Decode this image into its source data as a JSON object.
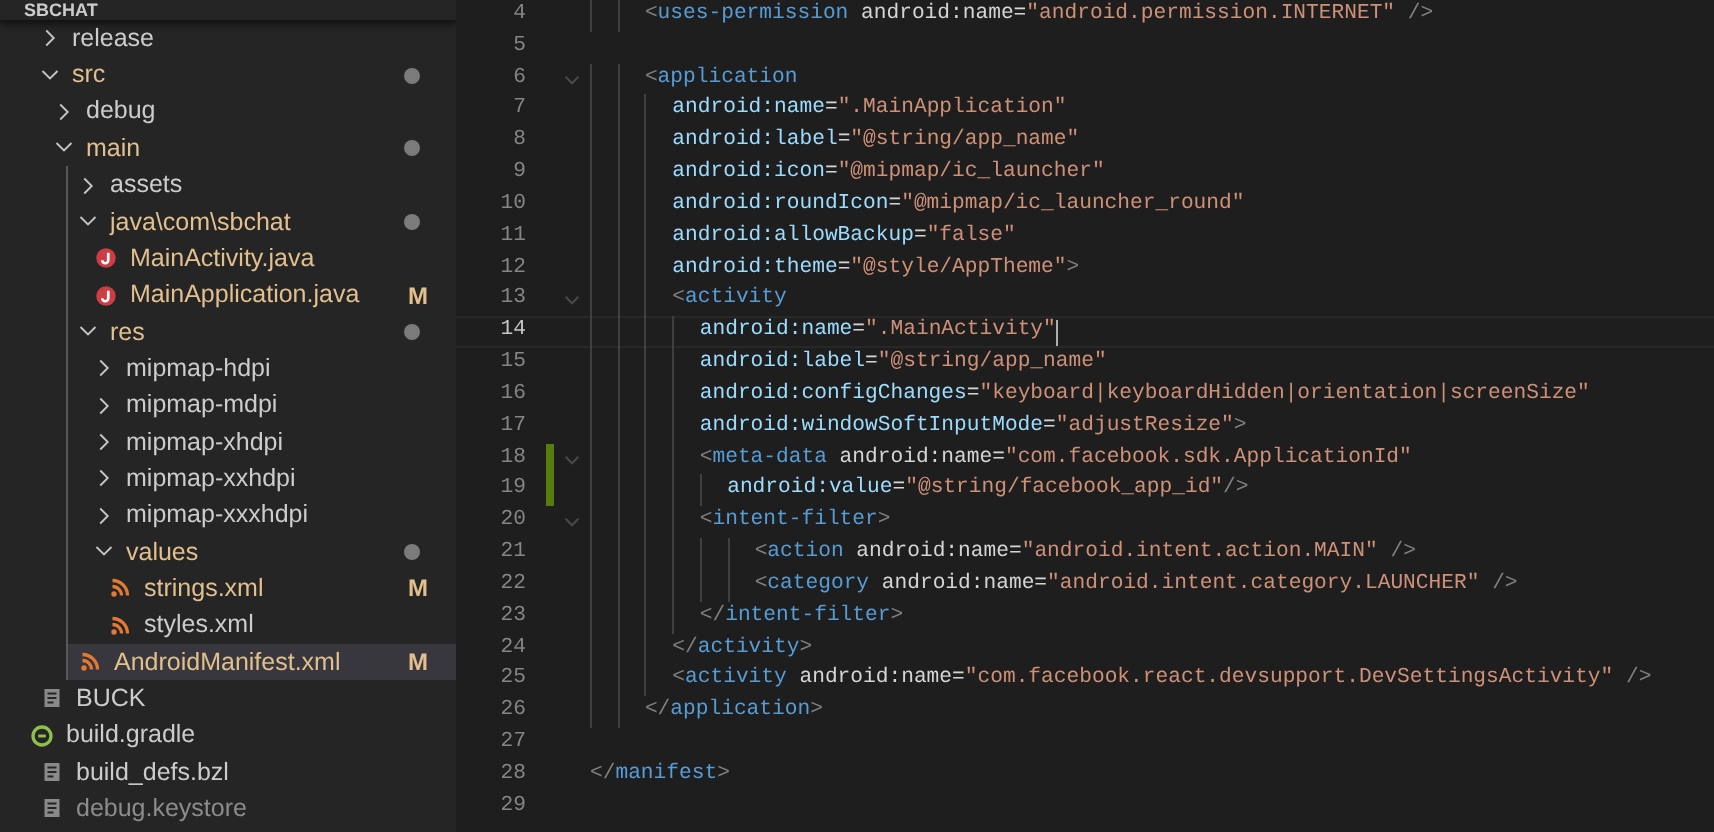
{
  "explorer": {
    "title": "SBCHAT",
    "items": [
      {
        "name": "release",
        "kind": "folder",
        "expanded": false,
        "selected": false,
        "contains_changes": false
      },
      {
        "name": "src",
        "kind": "folder",
        "expanded": true,
        "selected": false,
        "contains_changes": true,
        "children": [
          {
            "name": "debug",
            "kind": "folder",
            "expanded": false,
            "selected": false,
            "contains_changes": false
          },
          {
            "name": "main",
            "kind": "folder",
            "expanded": true,
            "selected": false,
            "contains_changes": true,
            "children": [
              {
                "name": "assets",
                "kind": "folder",
                "expanded": false,
                "selected": false,
                "contains_changes": false
              },
              {
                "name": "java\\com\\sbchat",
                "kind": "folder",
                "expanded": true,
                "selected": false,
                "contains_changes": true,
                "children": [
                  {
                    "name": "MainActivity.java",
                    "kind": "java",
                    "selected": false,
                    "modified": true,
                    "ignored": false
                  },
                  {
                    "name": "MainApplication.java",
                    "kind": "java",
                    "selected": false,
                    "modified": true,
                    "ignored": false,
                    "badge": "M"
                  }
                ]
              },
              {
                "name": "res",
                "kind": "folder",
                "expanded": true,
                "selected": false,
                "contains_changes": true,
                "children": [
                  {
                    "name": "mipmap-hdpi",
                    "kind": "folder",
                    "expanded": false,
                    "selected": false,
                    "contains_changes": false
                  },
                  {
                    "name": "mipmap-mdpi",
                    "kind": "folder",
                    "expanded": false,
                    "selected": false,
                    "contains_changes": false
                  },
                  {
                    "name": "mipmap-xhdpi",
                    "kind": "folder",
                    "expanded": false,
                    "selected": false,
                    "contains_changes": false
                  },
                  {
                    "name": "mipmap-xxhdpi",
                    "kind": "folder",
                    "expanded": false,
                    "selected": false,
                    "contains_changes": false
                  },
                  {
                    "name": "mipmap-xxxhdpi",
                    "kind": "folder",
                    "expanded": false,
                    "selected": false,
                    "contains_changes": false
                  },
                  {
                    "name": "values",
                    "kind": "folder",
                    "expanded": true,
                    "selected": false,
                    "contains_changes": true,
                    "children": [
                      {
                        "name": "strings.xml",
                        "kind": "xml",
                        "selected": false,
                        "modified": true,
                        "ignored": false,
                        "badge": "M"
                      },
                      {
                        "name": "styles.xml",
                        "kind": "xml",
                        "selected": false,
                        "modified": false,
                        "ignored": false
                      }
                    ]
                  }
                ]
              },
              {
                "name": "AndroidManifest.xml",
                "kind": "xml",
                "selected": true,
                "modified": true,
                "ignored": false,
                "badge": "M"
              }
            ]
          }
        ]
      },
      {
        "name": "BUCK",
        "kind": "file",
        "selected": false,
        "modified": false,
        "ignored": false
      },
      {
        "name": "build.gradle",
        "kind": "gradle",
        "selected": false,
        "modified": false,
        "ignored": false
      },
      {
        "name": "build_defs.bzl",
        "kind": "file",
        "selected": false,
        "modified": false,
        "ignored": false
      },
      {
        "name": "debug.keystore",
        "kind": "file",
        "selected": false,
        "modified": false,
        "ignored": true
      }
    ]
  },
  "editor": {
    "lines": [
      {
        "number": "4",
        "code": "    <uses-permission android:name=\"android.permission.INTERNET\" />"
      },
      {
        "number": "5"
      },
      {
        "number": "6",
        "code": "    <application",
        "fold": true
      },
      {
        "number": "7",
        "code": "      android:name=\".MainApplication\""
      },
      {
        "number": "8",
        "code": "      android:label=\"@string/app_name\""
      },
      {
        "number": "9",
        "code": "      android:icon=\"@mipmap/ic_launcher\""
      },
      {
        "number": "10",
        "code": "      android:roundIcon=\"@mipmap/ic_launcher_round\""
      },
      {
        "number": "11",
        "code": "      android:allowBackup=\"false\""
      },
      {
        "number": "12",
        "code": "      android:theme=\"@style/AppTheme\">"
      },
      {
        "number": "13",
        "code": "      <activity",
        "fold": true
      },
      {
        "number": "14",
        "code": "        android:name=\".MainActivity\"",
        "current": true
      },
      {
        "number": "15",
        "code": "        android:label=\"@string/app_name\""
      },
      {
        "number": "16",
        "code": "        android:configChanges=\"keyboard|keyboardHidden|orientation|screenSize\""
      },
      {
        "number": "17",
        "code": "        android:windowSoftInputMode=\"adjustResize\">"
      },
      {
        "number": "18",
        "code": "        <meta-data android:name=\"com.facebook.sdk.ApplicationId\"",
        "fold": true,
        "added": true
      },
      {
        "number": "19",
        "code": "          android:value=\"@string/facebook_app_id\"/>",
        "added": true
      },
      {
        "number": "20",
        "code": "        <intent-filter>",
        "fold": true
      },
      {
        "number": "21",
        "code": "            <action android:name=\"android.intent.action.MAIN\" />"
      },
      {
        "number": "22",
        "code": "            <category android:name=\"android.intent.category.LAUNCHER\" />"
      },
      {
        "number": "23",
        "code": "        </intent-filter>"
      },
      {
        "number": "24",
        "code": "      </activity>"
      },
      {
        "number": "25",
        "code": "      <activity android:name=\"com.facebook.react.devsupport.DevSettingsActivity\" />"
      },
      {
        "number": "26",
        "code": "    </application>"
      },
      {
        "number": "27"
      },
      {
        "number": "28",
        "code": "</manifest>"
      },
      {
        "number": "29"
      }
    ]
  }
}
